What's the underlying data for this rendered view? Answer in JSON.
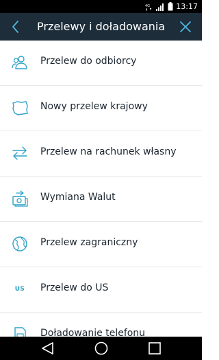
{
  "status_bar": {
    "time": "13:17",
    "icons": [
      "lte-icon",
      "signal-icon",
      "battery-icon"
    ]
  },
  "header": {
    "title": "Przelewy i doładowania",
    "back_icon": "chevron-left-icon",
    "close_icon": "close-icon"
  },
  "menu": {
    "items": [
      {
        "label": "Przelew do odbiorcy",
        "icon": "recipients-icon"
      },
      {
        "label": "Nowy przelew krajowy",
        "icon": "poland-map-icon"
      },
      {
        "label": "Przelew na rachunek własny",
        "icon": "transfer-arrows-icon"
      },
      {
        "label": "Wymiana Walut",
        "icon": "currency-exchange-icon"
      },
      {
        "label": "Przelew zagraniczny",
        "icon": "globe-icon"
      },
      {
        "label": "Przelew do US",
        "icon_text": "US"
      },
      {
        "label": "Doładowanie telefonu",
        "icon": "sim-card-icon"
      }
    ]
  },
  "nav_bar": {
    "icons": [
      "back-triangle-icon",
      "home-circle-icon",
      "recents-square-icon"
    ]
  },
  "colors": {
    "appbar": "#1d2d3a",
    "accent": "#2fa3c7",
    "divider": "#e6e8ea",
    "text": "#1c2630"
  }
}
